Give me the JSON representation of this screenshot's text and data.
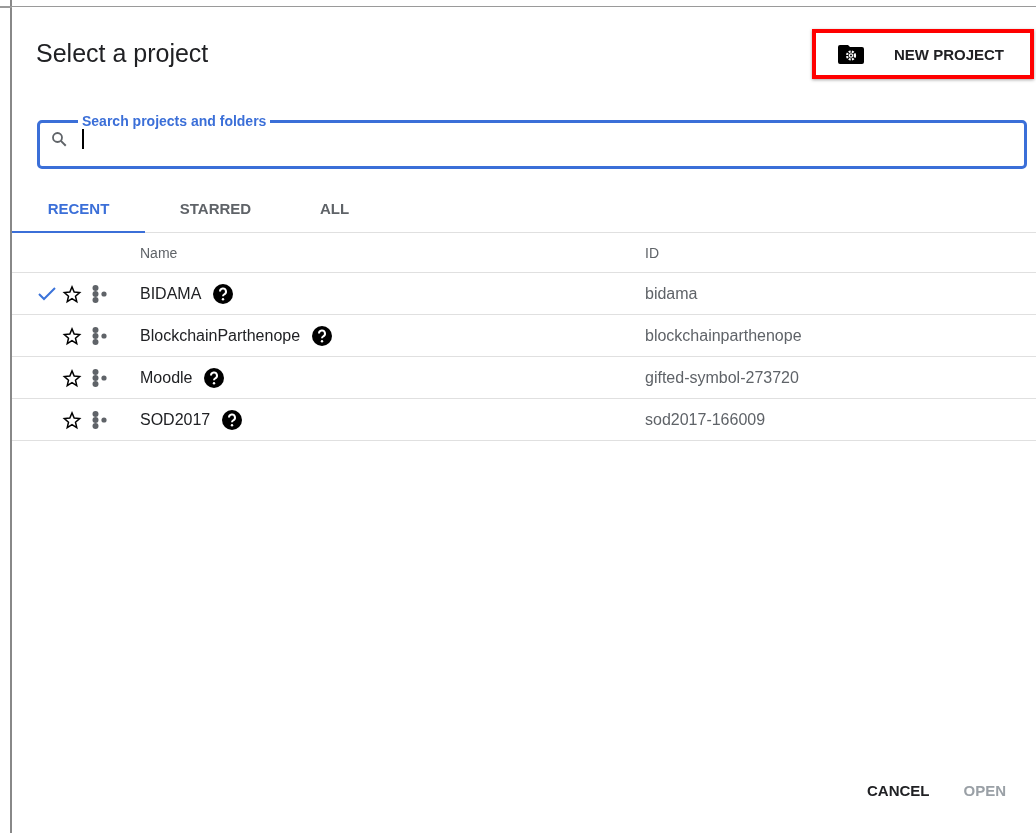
{
  "dialog": {
    "title": "Select a project",
    "new_project_button": {
      "label": "NEW PROJECT",
      "highlighted": true
    }
  },
  "search": {
    "label": "Search projects and folders",
    "focused": true
  },
  "tabs": [
    {
      "label": "RECENT",
      "selected": true
    },
    {
      "label": "STARRED",
      "selected": false
    },
    {
      "label": "ALL",
      "selected": false
    }
  ],
  "table": {
    "columns": [
      "Name",
      "ID"
    ],
    "rows": [
      {
        "name": "BIDAMA",
        "id": "bidama",
        "selected": true,
        "starred": false
      },
      {
        "name": "BlockchainParthenope",
        "id": "blockchainparthenope",
        "selected": false,
        "starred": false
      },
      {
        "name": "Moodle",
        "id": "gifted-symbol-273720",
        "selected": false,
        "starred": false
      },
      {
        "name": "SOD2017",
        "id": "sod2017-166009",
        "selected": false,
        "starred": false
      }
    ]
  },
  "buttons": [
    {
      "label": "CANCEL",
      "disabled": false
    },
    {
      "label": "OPEN",
      "disabled": true
    }
  ]
}
